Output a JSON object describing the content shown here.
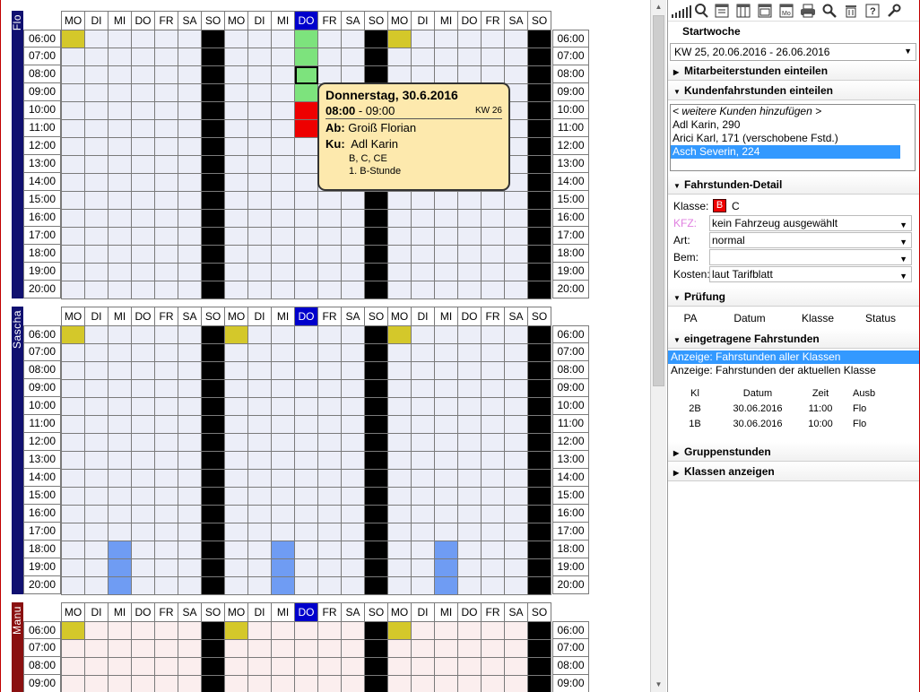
{
  "calendar": {
    "days": [
      "MO",
      "DI",
      "MI",
      "DO",
      "FR",
      "SA",
      "SO",
      "MO",
      "DI",
      "MI",
      "DO",
      "FR",
      "SA",
      "SO",
      "MO",
      "DI",
      "MI",
      "DO",
      "FR",
      "SA",
      "SO"
    ],
    "today_index": 10,
    "hours": [
      "06:00",
      "07:00",
      "08:00",
      "09:00",
      "10:00",
      "11:00",
      "12:00",
      "13:00",
      "14:00",
      "15:00",
      "16:00",
      "17:00",
      "18:00",
      "19:00",
      "20:00"
    ],
    "employees": [
      {
        "name": "Flo",
        "color": "#101070",
        "rows": 15,
        "pink": false,
        "marks": [
          {
            "c": 0,
            "r": 0,
            "t": "y"
          },
          {
            "c": 14,
            "r": 0,
            "t": "y"
          },
          {
            "c": 10,
            "r": 0,
            "t": "g"
          },
          {
            "c": 10,
            "r": 1,
            "t": "g"
          },
          {
            "c": 10,
            "r": 2,
            "t": "g",
            "sel": true
          },
          {
            "c": 10,
            "r": 3,
            "t": "g"
          },
          {
            "c": 10,
            "r": 4,
            "t": "r"
          },
          {
            "c": 10,
            "r": 5,
            "t": "r"
          }
        ]
      },
      {
        "name": "Sascha",
        "color": "#101070",
        "rows": 15,
        "pink": false,
        "marks": [
          {
            "c": 0,
            "r": 0,
            "t": "y"
          },
          {
            "c": 7,
            "r": 0,
            "t": "y"
          },
          {
            "c": 14,
            "r": 0,
            "t": "y"
          },
          {
            "c": 2,
            "r": 12,
            "t": "b"
          },
          {
            "c": 2,
            "r": 13,
            "t": "b"
          },
          {
            "c": 2,
            "r": 14,
            "t": "b"
          },
          {
            "c": 9,
            "r": 12,
            "t": "b"
          },
          {
            "c": 9,
            "r": 13,
            "t": "b"
          },
          {
            "c": 9,
            "r": 14,
            "t": "b"
          },
          {
            "c": 16,
            "r": 12,
            "t": "b"
          },
          {
            "c": 16,
            "r": 13,
            "t": "b"
          },
          {
            "c": 16,
            "r": 14,
            "t": "b"
          }
        ]
      },
      {
        "name": "Manu",
        "color": "#8a1010",
        "rows": 4,
        "pink": true,
        "marks": [
          {
            "c": 0,
            "r": 0,
            "t": "y"
          },
          {
            "c": 7,
            "r": 0,
            "t": "y"
          },
          {
            "c": 14,
            "r": 0,
            "t": "y"
          }
        ]
      }
    ]
  },
  "tooltip": {
    "date": "Donnerstag, 30.6.2016",
    "time_start": "08:00",
    "time_end": " - 09:00",
    "kw": "KW 26",
    "ab_label": "Ab:",
    "ab_value": "Groiß Florian",
    "ku_label": "Ku:",
    "ku_value": "Adl Karin",
    "classes": "B, C, CE",
    "lesson": "1. B-Stunde"
  },
  "panel": {
    "startwoche_label": "Startwoche",
    "week_value": "KW 25,   20.06.2016 - 26.06.2016",
    "sec_mitarbeiter": "Mitarbeiterstunden einteilen",
    "sec_kunden": "Kundenfahrstunden einteilen",
    "kunden_list": [
      {
        "label": "< weitere Kunden hinzufügen >",
        "style": "it"
      },
      {
        "label": "Adl Karin, 290",
        "style": ""
      },
      {
        "label": "Arici Karl, 171 (verschobene Fstd.)",
        "style": ""
      },
      {
        "label": "Asch Severin, 224",
        "style": "hl"
      }
    ],
    "sec_detail": "Fahrstunden-Detail",
    "klasse_label": "Klasse:",
    "klasse_sel": "B",
    "klasse_other": "C",
    "kfz_label": "KFZ:",
    "kfz_value": "kein Fahrzeug ausgewählt",
    "art_label": "Art:",
    "art_value": "normal",
    "bem_label": "Bem:",
    "bem_value": "",
    "kosten_label": "Kosten:",
    "kosten_value": "laut Tarifblatt",
    "sec_pruefung": "Prüfung",
    "pruefung_cols": [
      "PA",
      "Datum",
      "Klasse",
      "Status"
    ],
    "sec_eingetragen": "eingetragene Fahrstunden",
    "anzeige_all": "Anzeige: Fahrstunden aller Klassen",
    "anzeige_current": "Anzeige: Fahrstunden der aktuellen Klasse",
    "fs_cols": [
      "Kl",
      "Datum",
      "Zeit",
      "Ausb"
    ],
    "fs_rows": [
      [
        "2B",
        "30.06.2016",
        "11:00",
        "Flo"
      ],
      [
        "1B",
        "30.06.2016",
        "10:00",
        "Flo"
      ]
    ],
    "sec_gruppen": "Gruppenstunden",
    "sec_klassen": "Klassen anzeigen"
  }
}
